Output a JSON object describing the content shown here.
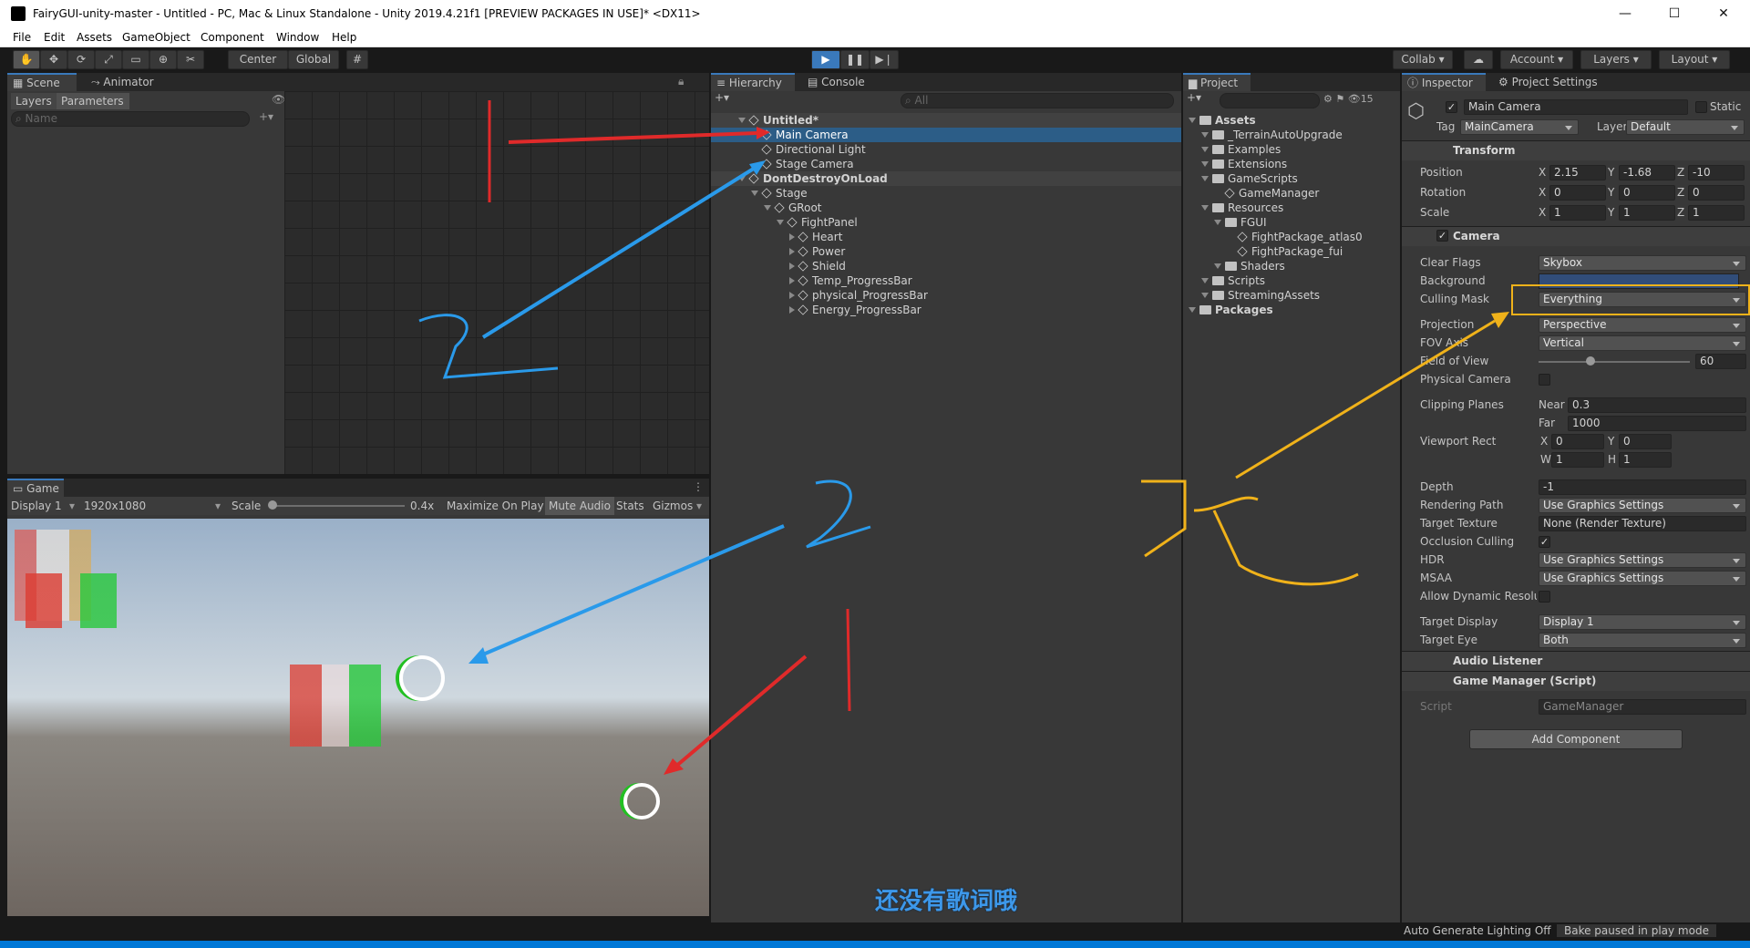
{
  "window": {
    "title": "FairyGUI-unity-master - Untitled - PC, Mac & Linux Standalone - Unity 2019.4.21f1 [PREVIEW PACKAGES IN USE]* <DX11>",
    "minimize": "—",
    "maximize": "☐",
    "close": "✕"
  },
  "menu": [
    "File",
    "Edit",
    "Assets",
    "GameObject",
    "Component",
    "Window",
    "Help"
  ],
  "toolbar": {
    "center": "Center",
    "global": "Global",
    "collab": "Collab ▾",
    "account": "Account",
    "layers": "Layers",
    "layout": "Layout"
  },
  "scene": {
    "tab_scene": "Scene",
    "tab_animator": "Animator",
    "layers": "Layers",
    "parameters": "Parameters",
    "name_placeholder": "Name"
  },
  "game": {
    "tab": "Game",
    "display": "Display 1",
    "resolution": "1920x1080",
    "scale_label": "Scale",
    "scale_value": "0.4x",
    "maximize": "Maximize On Play",
    "mute": "Mute Audio",
    "stats": "Stats",
    "gizmos": "Gizmos",
    "subtitle": "还没有歌词哦"
  },
  "hierarchy": {
    "tab": "Hierarchy",
    "console": "Console",
    "search_placeholder": "All",
    "rows": [
      {
        "label": "Untitled*",
        "indent": 0,
        "kind": "scene"
      },
      {
        "label": "Main Camera",
        "indent": 1,
        "kind": "sel"
      },
      {
        "label": "Directional Light",
        "indent": 1,
        "kind": "obj"
      },
      {
        "label": "Stage Camera",
        "indent": 1,
        "kind": "obj"
      },
      {
        "label": "DontDestroyOnLoad",
        "indent": 0,
        "kind": "scene"
      },
      {
        "label": "Stage",
        "indent": 1,
        "kind": "exp"
      },
      {
        "label": "GRoot",
        "indent": 2,
        "kind": "exp"
      },
      {
        "label": "FightPanel",
        "indent": 3,
        "kind": "exp"
      },
      {
        "label": "Heart",
        "indent": 4,
        "kind": "col"
      },
      {
        "label": "Power",
        "indent": 4,
        "kind": "col"
      },
      {
        "label": "Shield",
        "indent": 4,
        "kind": "col"
      },
      {
        "label": "Temp_ProgressBar",
        "indent": 4,
        "kind": "col"
      },
      {
        "label": "physical_ProgressBar",
        "indent": 4,
        "kind": "col"
      },
      {
        "label": "Energy_ProgressBar",
        "indent": 4,
        "kind": "col"
      }
    ]
  },
  "project": {
    "tab": "Project",
    "count": "15",
    "rows": [
      {
        "label": "Assets",
        "indent": 0,
        "bold": true
      },
      {
        "label": "_TerrainAutoUpgrade",
        "indent": 1
      },
      {
        "label": "Examples",
        "indent": 1
      },
      {
        "label": "Extensions",
        "indent": 1
      },
      {
        "label": "GameScripts",
        "indent": 1
      },
      {
        "label": "GameManager",
        "indent": 2,
        "file": true
      },
      {
        "label": "Resources",
        "indent": 1
      },
      {
        "label": "FGUI",
        "indent": 2
      },
      {
        "label": "FightPackage_atlas0",
        "indent": 3,
        "file": true
      },
      {
        "label": "FightPackage_fui",
        "indent": 3,
        "file": true
      },
      {
        "label": "Shaders",
        "indent": 2
      },
      {
        "label": "Scripts",
        "indent": 1
      },
      {
        "label": "StreamingAssets",
        "indent": 1
      },
      {
        "label": "Packages",
        "indent": 0,
        "bold": true
      }
    ]
  },
  "inspector": {
    "tab": "Inspector",
    "settings_tab": "Project Settings",
    "name": "Main Camera",
    "static": "Static",
    "tag_label": "Tag",
    "tag": "MainCamera",
    "layer_label": "Layer",
    "layer": "Default",
    "transform": {
      "title": "Transform",
      "position": "Position",
      "rotation": "Rotation",
      "scale": "Scale",
      "px": "2.15",
      "py": "-1.68",
      "pz": "-10",
      "rx": "0",
      "ry": "0",
      "rz": "0",
      "sx": "1",
      "sy": "1",
      "sz": "1"
    },
    "camera": {
      "title": "Camera",
      "clear_flags": "Clear Flags",
      "clear_flags_v": "Skybox",
      "background": "Background",
      "culling": "Culling Mask",
      "culling_v": "Everything",
      "projection": "Projection",
      "projection_v": "Perspective",
      "fov_axis": "FOV Axis",
      "fov_axis_v": "Vertical",
      "fov": "Field of View",
      "fov_v": "60",
      "physical": "Physical Camera",
      "clipping": "Clipping Planes",
      "near": "Near",
      "near_v": "0.3",
      "far": "Far",
      "far_v": "1000",
      "viewport": "Viewport Rect",
      "vx": "0",
      "vy": "0",
      "vw": "1",
      "vh": "1",
      "depth": "Depth",
      "depth_v": "-1",
      "rpath": "Rendering Path",
      "rpath_v": "Use Graphics Settings",
      "ttex": "Target Texture",
      "ttex_v": "None (Render Texture)",
      "occ": "Occlusion Culling",
      "hdr": "HDR",
      "hdr_v": "Use Graphics Settings",
      "msaa": "MSAA",
      "msaa_v": "Use Graphics Settings",
      "dyn": "Allow Dynamic Resolut",
      "tdisp": "Target Display",
      "tdisp_v": "Display 1",
      "teye": "Target Eye",
      "teye_v": "Both"
    },
    "audio": "Audio Listener",
    "gm": "Game Manager (Script)",
    "script_label": "Script",
    "script_v": "GameManager",
    "add": "Add Component"
  },
  "status": {
    "lighting": "Auto Generate Lighting Off",
    "bake": "Bake paused in play mode"
  },
  "annotations": {
    "one": "1",
    "two": "2",
    "gai": "改"
  }
}
